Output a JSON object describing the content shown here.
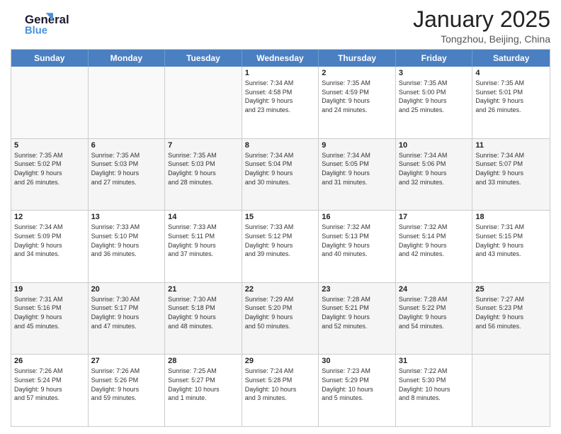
{
  "logo": {
    "line1": "General",
    "line2": "Blue"
  },
  "title": "January 2025",
  "location": "Tongzhou, Beijing, China",
  "dayHeaders": [
    "Sunday",
    "Monday",
    "Tuesday",
    "Wednesday",
    "Thursday",
    "Friday",
    "Saturday"
  ],
  "weeks": [
    [
      {
        "day": "",
        "info": ""
      },
      {
        "day": "",
        "info": ""
      },
      {
        "day": "",
        "info": ""
      },
      {
        "day": "1",
        "info": "Sunrise: 7:34 AM\nSunset: 4:58 PM\nDaylight: 9 hours\nand 23 minutes."
      },
      {
        "day": "2",
        "info": "Sunrise: 7:35 AM\nSunset: 4:59 PM\nDaylight: 9 hours\nand 24 minutes."
      },
      {
        "day": "3",
        "info": "Sunrise: 7:35 AM\nSunset: 5:00 PM\nDaylight: 9 hours\nand 25 minutes."
      },
      {
        "day": "4",
        "info": "Sunrise: 7:35 AM\nSunset: 5:01 PM\nDaylight: 9 hours\nand 26 minutes."
      }
    ],
    [
      {
        "day": "5",
        "info": "Sunrise: 7:35 AM\nSunset: 5:02 PM\nDaylight: 9 hours\nand 26 minutes."
      },
      {
        "day": "6",
        "info": "Sunrise: 7:35 AM\nSunset: 5:03 PM\nDaylight: 9 hours\nand 27 minutes."
      },
      {
        "day": "7",
        "info": "Sunrise: 7:35 AM\nSunset: 5:03 PM\nDaylight: 9 hours\nand 28 minutes."
      },
      {
        "day": "8",
        "info": "Sunrise: 7:34 AM\nSunset: 5:04 PM\nDaylight: 9 hours\nand 30 minutes."
      },
      {
        "day": "9",
        "info": "Sunrise: 7:34 AM\nSunset: 5:05 PM\nDaylight: 9 hours\nand 31 minutes."
      },
      {
        "day": "10",
        "info": "Sunrise: 7:34 AM\nSunset: 5:06 PM\nDaylight: 9 hours\nand 32 minutes."
      },
      {
        "day": "11",
        "info": "Sunrise: 7:34 AM\nSunset: 5:07 PM\nDaylight: 9 hours\nand 33 minutes."
      }
    ],
    [
      {
        "day": "12",
        "info": "Sunrise: 7:34 AM\nSunset: 5:09 PM\nDaylight: 9 hours\nand 34 minutes."
      },
      {
        "day": "13",
        "info": "Sunrise: 7:33 AM\nSunset: 5:10 PM\nDaylight: 9 hours\nand 36 minutes."
      },
      {
        "day": "14",
        "info": "Sunrise: 7:33 AM\nSunset: 5:11 PM\nDaylight: 9 hours\nand 37 minutes."
      },
      {
        "day": "15",
        "info": "Sunrise: 7:33 AM\nSunset: 5:12 PM\nDaylight: 9 hours\nand 39 minutes."
      },
      {
        "day": "16",
        "info": "Sunrise: 7:32 AM\nSunset: 5:13 PM\nDaylight: 9 hours\nand 40 minutes."
      },
      {
        "day": "17",
        "info": "Sunrise: 7:32 AM\nSunset: 5:14 PM\nDaylight: 9 hours\nand 42 minutes."
      },
      {
        "day": "18",
        "info": "Sunrise: 7:31 AM\nSunset: 5:15 PM\nDaylight: 9 hours\nand 43 minutes."
      }
    ],
    [
      {
        "day": "19",
        "info": "Sunrise: 7:31 AM\nSunset: 5:16 PM\nDaylight: 9 hours\nand 45 minutes."
      },
      {
        "day": "20",
        "info": "Sunrise: 7:30 AM\nSunset: 5:17 PM\nDaylight: 9 hours\nand 47 minutes."
      },
      {
        "day": "21",
        "info": "Sunrise: 7:30 AM\nSunset: 5:18 PM\nDaylight: 9 hours\nand 48 minutes."
      },
      {
        "day": "22",
        "info": "Sunrise: 7:29 AM\nSunset: 5:20 PM\nDaylight: 9 hours\nand 50 minutes."
      },
      {
        "day": "23",
        "info": "Sunrise: 7:28 AM\nSunset: 5:21 PM\nDaylight: 9 hours\nand 52 minutes."
      },
      {
        "day": "24",
        "info": "Sunrise: 7:28 AM\nSunset: 5:22 PM\nDaylight: 9 hours\nand 54 minutes."
      },
      {
        "day": "25",
        "info": "Sunrise: 7:27 AM\nSunset: 5:23 PM\nDaylight: 9 hours\nand 56 minutes."
      }
    ],
    [
      {
        "day": "26",
        "info": "Sunrise: 7:26 AM\nSunset: 5:24 PM\nDaylight: 9 hours\nand 57 minutes."
      },
      {
        "day": "27",
        "info": "Sunrise: 7:26 AM\nSunset: 5:26 PM\nDaylight: 9 hours\nand 59 minutes."
      },
      {
        "day": "28",
        "info": "Sunrise: 7:25 AM\nSunset: 5:27 PM\nDaylight: 10 hours\nand 1 minute."
      },
      {
        "day": "29",
        "info": "Sunrise: 7:24 AM\nSunset: 5:28 PM\nDaylight: 10 hours\nand 3 minutes."
      },
      {
        "day": "30",
        "info": "Sunrise: 7:23 AM\nSunset: 5:29 PM\nDaylight: 10 hours\nand 5 minutes."
      },
      {
        "day": "31",
        "info": "Sunrise: 7:22 AM\nSunset: 5:30 PM\nDaylight: 10 hours\nand 8 minutes."
      },
      {
        "day": "",
        "info": ""
      }
    ]
  ]
}
